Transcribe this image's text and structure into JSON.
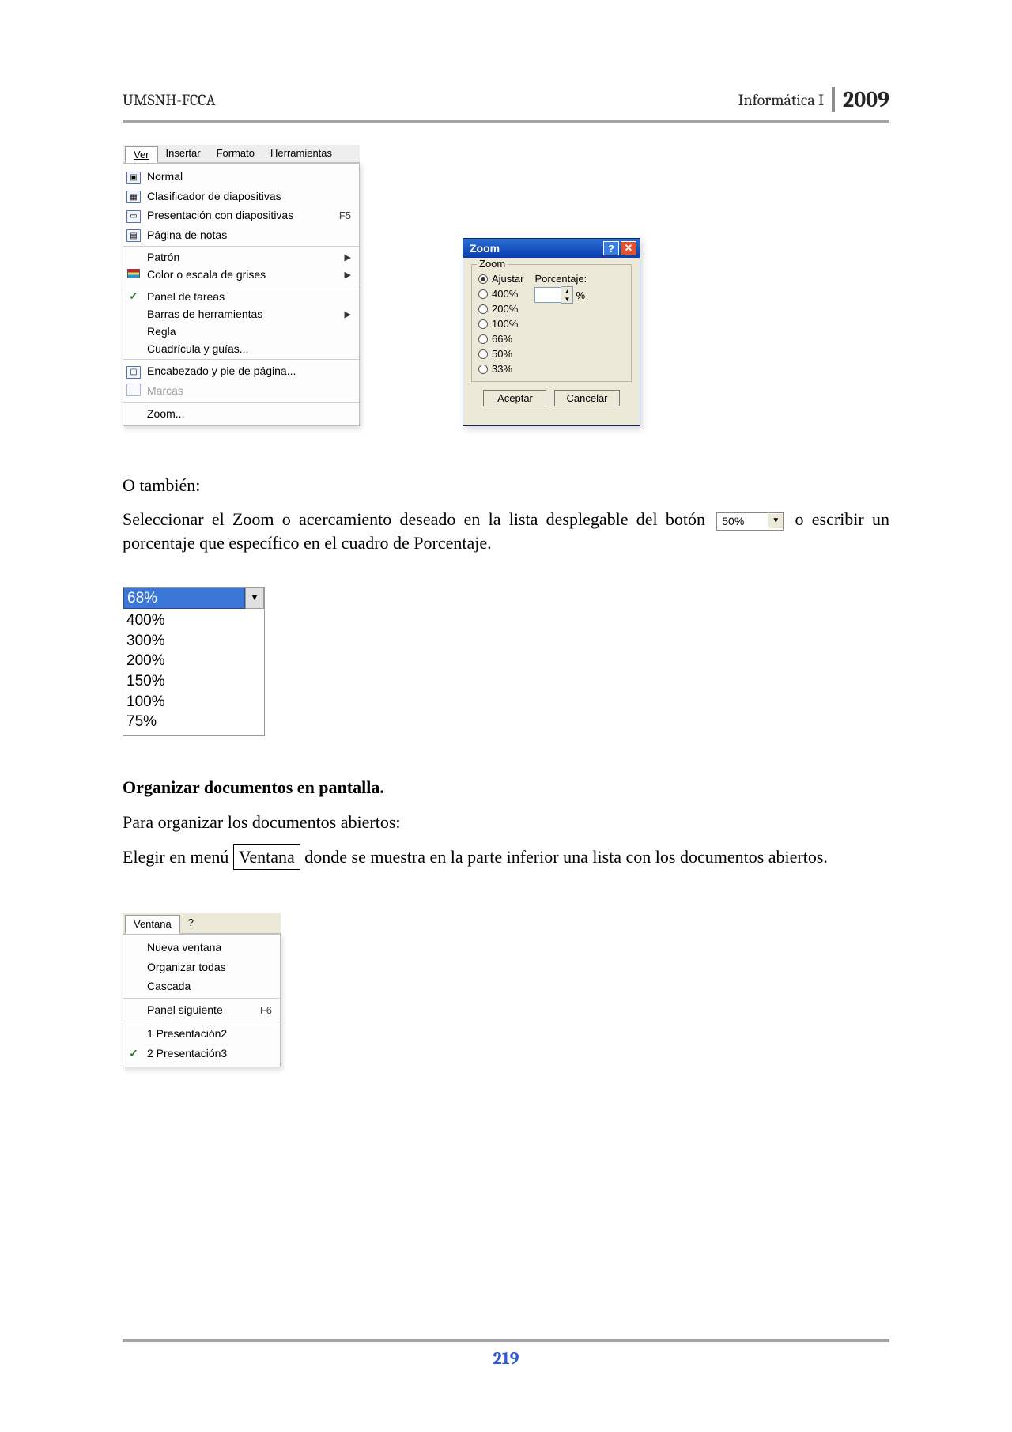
{
  "header": {
    "left": "UMSNH-FCCA",
    "course": "Informática I",
    "year": "2009"
  },
  "ver_menu": {
    "tabs": [
      "Ver",
      "Insertar",
      "Formato",
      "Herramientas"
    ],
    "items": {
      "normal": "Normal",
      "clasificador": "Clasificador de diapositivas",
      "presentacion": "Presentación con diapositivas",
      "presentacion_key": "F5",
      "pagina_notas": "Página de notas",
      "patron": "Patrón",
      "colorescala": "Color o escala de grises",
      "panel_tareas": "Panel de tareas",
      "barras": "Barras de herramientas",
      "regla": "Regla",
      "cuadricula": "Cuadrícula y guías...",
      "encabezado": "Encabezado y pie de página...",
      "marcas": "Marcas",
      "zoom": "Zoom..."
    }
  },
  "zoom_dialog": {
    "title": "Zoom",
    "group": "Zoom",
    "ajustar": "Ajustar",
    "porcentaje_label": "Porcentaje:",
    "opts": [
      "400%",
      "200%",
      "100%",
      "66%",
      "50%",
      "33%"
    ],
    "pct_suffix": "%",
    "aceptar": "Aceptar",
    "cancelar": "Cancelar"
  },
  "body": {
    "otambien": "O también:",
    "intro_zoom": "Seleccionar el Zoom o acercamiento deseado en la lista desplegable del botón",
    "intro_zoom_end": "o escribir un porcentaje que específico en el cuadro de Porcentaje.",
    "dd_value": "50%",
    "section_title": "Organizar documentos en pantalla.",
    "para_org": "Para organizar los documentos abiertos:",
    "para_elegir_a": "Elegir en menú",
    "ventana_box": "Ventana",
    "para_elegir_b": "donde se muestra en la parte inferior una lista con los documentos abiertos."
  },
  "open_dd": {
    "selected": "68%",
    "options": [
      "400%",
      "300%",
      "200%",
      "150%",
      "100%",
      "75%"
    ]
  },
  "ventana_menu": {
    "tabs": [
      "Ventana",
      "?"
    ],
    "nueva": "Nueva ventana",
    "organizar": "Organizar todas",
    "cascada": "Cascada",
    "panel_sig": "Panel siguiente",
    "panel_sig_key": "F6",
    "pres1": "1 Presentación2",
    "pres2": "2 Presentación3"
  },
  "footer": {
    "page": "219"
  }
}
